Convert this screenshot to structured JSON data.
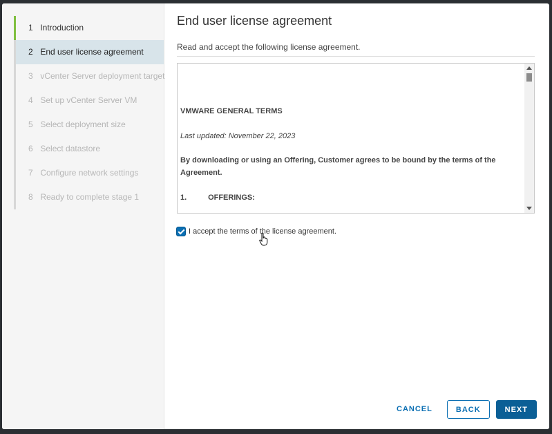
{
  "wizard": {
    "steps": [
      {
        "num": "1",
        "label": "Introduction",
        "state": "done"
      },
      {
        "num": "2",
        "label": "End user license agreement",
        "state": "active"
      },
      {
        "num": "3",
        "label": "vCenter Server deployment target",
        "state": "pending"
      },
      {
        "num": "4",
        "label": "Set up vCenter Server VM",
        "state": "pending"
      },
      {
        "num": "5",
        "label": "Select deployment size",
        "state": "pending"
      },
      {
        "num": "6",
        "label": "Select datastore",
        "state": "pending"
      },
      {
        "num": "7",
        "label": "Configure network settings",
        "state": "pending"
      },
      {
        "num": "8",
        "label": "Ready to complete stage 1",
        "state": "pending"
      }
    ]
  },
  "page": {
    "title": "End user license agreement",
    "subtitle": "Read and accept the following license agreement."
  },
  "eula": {
    "heading": "VMWARE GENERAL TERMS",
    "updated": "Last updated: November 22, 2023",
    "paragraph": "By downloading or using an Offering, Customer agrees to be bound by the terms of the Agreement.",
    "section_num": "1.",
    "section_title": "OFFERINGS:"
  },
  "accept": {
    "label": "I accept the terms of the license agreement.",
    "checked": true
  },
  "footer": {
    "cancel": "CANCEL",
    "back": "BACK",
    "next": "NEXT"
  },
  "colors": {
    "accent": "#0b6fb3",
    "done": "#7fbf3f",
    "active_bg": "#d8e4ea"
  }
}
